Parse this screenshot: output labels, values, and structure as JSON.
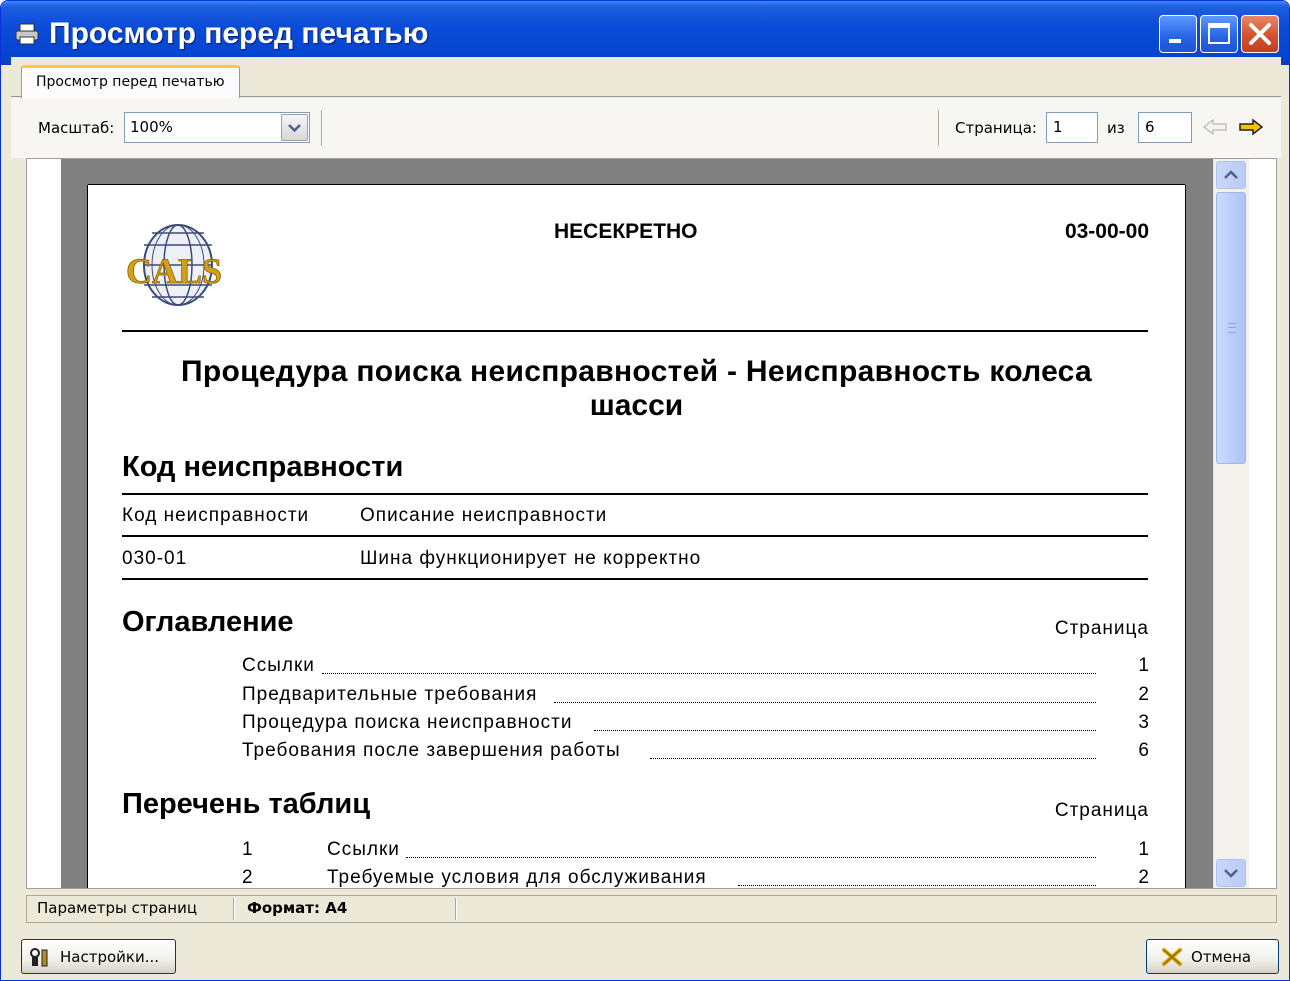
{
  "window": {
    "title": "Просмотр перед печатью"
  },
  "tabs": [
    {
      "label": "Просмотр перед печатью"
    }
  ],
  "toolbar": {
    "zoom_label": "Масштаб:",
    "zoom_value": "100%",
    "page_label": "Страница:",
    "page_current": "1",
    "of_label": "из",
    "page_total": "6"
  },
  "document": {
    "security_marking": "НЕСЕКРЕТНО",
    "doc_code": "03-00-00",
    "logo_text": "CALS",
    "title_line1": "Процедура поиска неисправностей - Неисправность колеса",
    "title_line2": "шасси",
    "fault_code_heading": "Код неисправности",
    "fault_table": {
      "headers": [
        "Код неисправности",
        "Описание неисправности"
      ],
      "rows": [
        [
          "030-01",
          "Шина функционирует не корректно"
        ]
      ]
    },
    "toc_heading": "Оглавление",
    "toc_page_header": "Страница",
    "toc": [
      {
        "title": "Ссылки",
        "page": "1"
      },
      {
        "title": "Предварительные требования",
        "page": "2"
      },
      {
        "title": "Процедура поиска неисправности",
        "page": "3"
      },
      {
        "title": "Требования после завершения работы",
        "page": "6"
      }
    ],
    "tables_heading": "Перечень таблиц",
    "tables_page_header": "Страница",
    "tables": [
      {
        "num": "1",
        "title": "Ссылки",
        "page": "1"
      },
      {
        "num": "2",
        "title": "Требуемые условия для обслуживания",
        "page": "2"
      }
    ]
  },
  "statusbar": {
    "page_settings": "Параметры страниц",
    "format": "Формат: А4"
  },
  "buttons": {
    "settings": "Настройки...",
    "cancel": "Отмена"
  }
}
